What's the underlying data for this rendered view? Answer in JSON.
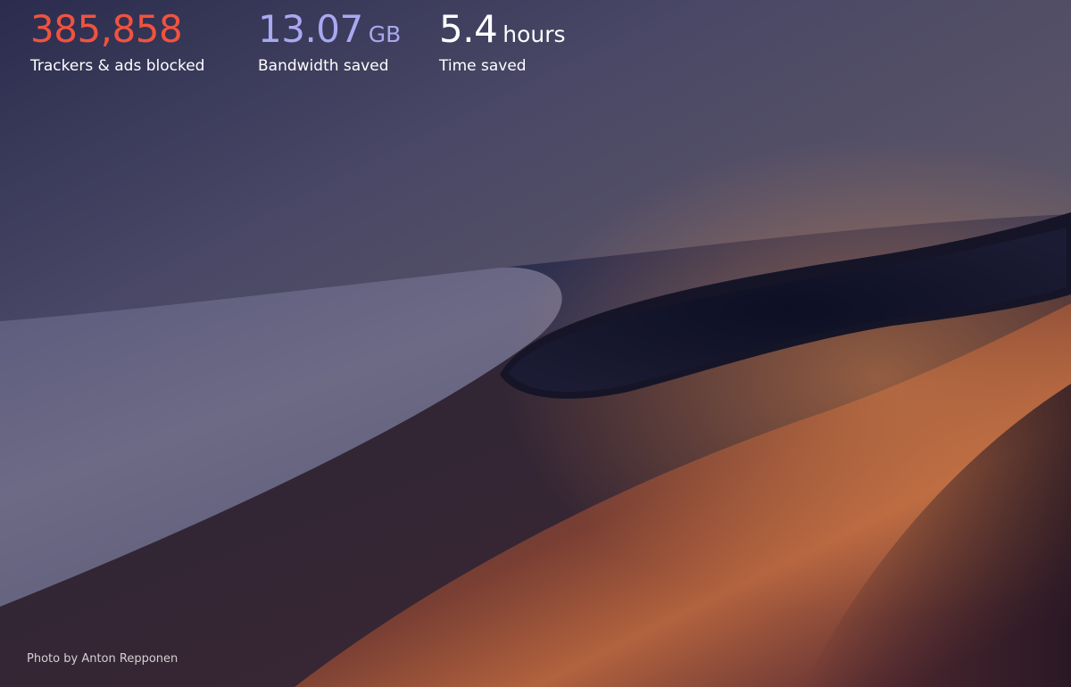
{
  "stats": {
    "trackers": {
      "value": "385,858",
      "unit": "",
      "label": "Trackers & ads blocked",
      "color": "#f0533f"
    },
    "bandwidth": {
      "value": "13.07",
      "unit": "GB",
      "label": "Bandwidth saved",
      "color": "#a9a8f2"
    },
    "time": {
      "value": "5.4",
      "unit": "hours",
      "label": "Time saved",
      "color": "#ffffff"
    }
  },
  "background": {
    "credit_prefix": "Photo by",
    "credit_author": "Anton Repponen"
  }
}
